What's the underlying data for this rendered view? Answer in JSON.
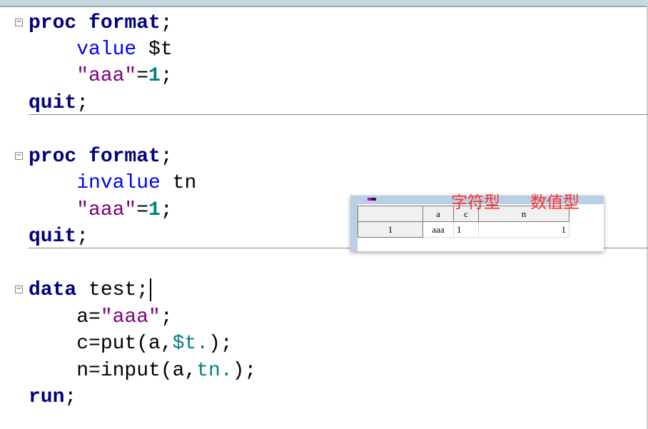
{
  "editor": {
    "lines": [
      [
        {
          "t": "proc format",
          "c": "kw"
        },
        {
          "t": ";",
          "c": "pl"
        }
      ],
      [
        {
          "t": "    value",
          "c": "fn"
        },
        {
          "t": " $t",
          "c": "pl"
        }
      ],
      [
        {
          "t": "    \"aaa\"",
          "c": "str"
        },
        {
          "t": "=",
          "c": "pl"
        },
        {
          "t": "1",
          "c": "num"
        },
        {
          "t": ";",
          "c": "pl"
        }
      ],
      [
        {
          "t": "quit",
          "c": "kw"
        },
        {
          "t": ";",
          "c": "pl"
        }
      ],
      [
        {
          "t": "proc format",
          "c": "kw"
        },
        {
          "t": ";",
          "c": "pl"
        }
      ],
      [
        {
          "t": "    invalue",
          "c": "fn"
        },
        {
          "t": " tn",
          "c": "pl"
        }
      ],
      [
        {
          "t": "    \"aaa\"",
          "c": "str"
        },
        {
          "t": "=",
          "c": "pl"
        },
        {
          "t": "1",
          "c": "num"
        },
        {
          "t": ";",
          "c": "pl"
        }
      ],
      [
        {
          "t": "quit",
          "c": "kw"
        },
        {
          "t": ";",
          "c": "pl"
        }
      ],
      [
        {
          "t": "data",
          "c": "kw"
        },
        {
          "t": " test;",
          "c": "pl"
        }
      ],
      [
        {
          "t": "    a=",
          "c": "pl"
        },
        {
          "t": "\"aaa\"",
          "c": "str"
        },
        {
          "t": ";",
          "c": "pl"
        }
      ],
      [
        {
          "t": "    c=put(a,",
          "c": "pl"
        },
        {
          "t": "$t.",
          "c": "fmt"
        },
        {
          "t": ");",
          "c": "pl"
        }
      ],
      [
        {
          "t": "    n=input(a,",
          "c": "pl"
        },
        {
          "t": "tn.",
          "c": "fmt"
        },
        {
          "t": ");",
          "c": "pl"
        }
      ],
      [
        {
          "t": "run",
          "c": "kw"
        },
        {
          "t": ";",
          "c": "pl"
        }
      ]
    ],
    "fold_icon": "minus",
    "fold_symbol": "−"
  },
  "result_table": {
    "headers": [
      "",
      "a",
      "c",
      "n"
    ],
    "rows": [
      [
        "1",
        "aaa",
        "1",
        "1"
      ]
    ]
  },
  "annotations": {
    "char_type": "字符型",
    "num_type": "数值型",
    "color": "#ff3030"
  }
}
